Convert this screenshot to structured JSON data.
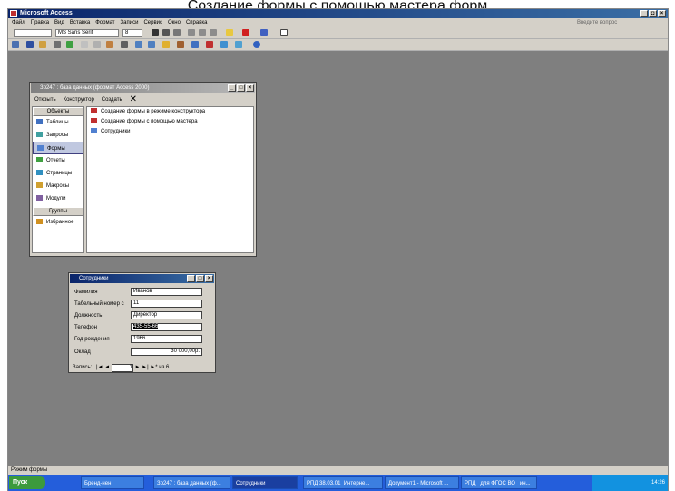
{
  "heading": "Создание формы с помощью мастера форм",
  "app_title": "Microsoft Access",
  "menu": [
    "Файл",
    "Правка",
    "Вид",
    "Вставка",
    "Формат",
    "Записи",
    "Сервис",
    "Окно",
    "Справка"
  ],
  "help_placeholder": "Введите вопрос",
  "font_name": "MS Sans Serif",
  "font_size": "8",
  "db_window": {
    "title": "Зр247 : база данных (формат Access 2000)",
    "toolbar": [
      "Открыть",
      "Конструктор",
      "Создать"
    ],
    "objects_header": "Объекты",
    "groups_header": "Группы",
    "objects": [
      "Таблицы",
      "Запросы",
      "Формы",
      "Отчеты",
      "Страницы",
      "Макросы",
      "Модули"
    ],
    "favorites": "Избранное",
    "items": [
      "Создание формы в режиме конструктора",
      "Создание формы с помощью мастера",
      "Сотрудники"
    ]
  },
  "form_window": {
    "title": "Сотрудники",
    "fields": [
      {
        "label": "Фамилия",
        "value": "Иванов"
      },
      {
        "label": "Табельный номер с",
        "value": "11"
      },
      {
        "label": "Должность",
        "value": "Директор"
      },
      {
        "label": "Телефон",
        "value": "435-55-66"
      },
      {
        "label": "Год рождения",
        "value": "1966"
      },
      {
        "label": "Оклад",
        "value": "30 000,00р."
      }
    ],
    "nav_label": "Запись:",
    "record": "1",
    "of_label": "из 6"
  },
  "status": "Режим формы",
  "taskbar": {
    "start": "Пуск",
    "tasks": [
      "Бренд-нен",
      "Зр247 : база данных (ф...",
      "Сотрудники",
      "РПД 38.03.01_Интерне...",
      "Документ1 - Microsoft ...",
      "РПД _для ФГОС ВО _ин..."
    ],
    "clock": "14:26"
  }
}
